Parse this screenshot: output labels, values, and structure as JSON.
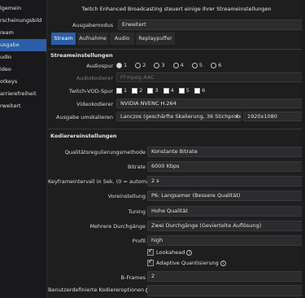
{
  "sidebar": {
    "items": [
      {
        "label": "lgemein"
      },
      {
        "label": "rscheinungsbild"
      },
      {
        "label": "ream"
      },
      {
        "label": "usgabe"
      },
      {
        "label": "udio"
      },
      {
        "label": "ideo"
      },
      {
        "label": "otkeys"
      },
      {
        "label": "arrierefreiheit"
      },
      {
        "label": "rweitert"
      }
    ],
    "active_index": 3
  },
  "banner": "Twitch Enhanced Broadcasting steuert einige Ihrer Streameinstellungen",
  "output_mode": {
    "label": "Ausgabemodus",
    "value": "Erweitert"
  },
  "tabs": [
    "Stream",
    "Aufnahme",
    "Audio",
    "Replaypuffer"
  ],
  "stream_section": {
    "title": "Streameinstellungen",
    "audio_track": {
      "label": "Audiospur",
      "options": [
        "1",
        "2",
        "3",
        "4",
        "5",
        "6"
      ],
      "selected": "1"
    },
    "audio_encoder": {
      "label": "Audiokodierer",
      "value": "FFmpeg AAC"
    },
    "vod_track": {
      "label": "Twitch-VOD-Spur",
      "options": [
        "1",
        "2",
        "3",
        "4",
        "5",
        "6"
      ]
    },
    "video_encoder": {
      "label": "Videokodierer",
      "value": "NVIDIA NVENC H.264"
    },
    "rescale": {
      "label": "Ausgabe umskalieren",
      "method": "Lanczos (geschärfte Skalierung, 36 Stichproben)",
      "resolution": "1920x1080"
    }
  },
  "encoder_section": {
    "title": "Kodierereinstellungen",
    "rate_control": {
      "label": "Qualitätsregulierungsmethode",
      "value": "Konstante Bitrate"
    },
    "bitrate": {
      "label": "Bitrate",
      "value": "6000 Kbps"
    },
    "keyframe": {
      "label": "Keyframeintervall in Sek. (0 = automatisch)",
      "value": "2 s"
    },
    "preset": {
      "label": "Voreinstellung",
      "value": "P6: Langsamer (Bessere Qualität)"
    },
    "tuning": {
      "label": "Tuning",
      "value": "Hohe Qualität"
    },
    "multipass": {
      "label": "Mehrere Durchgänge",
      "value": "Zwei Durchgänge (Geviertelte Auflösung)"
    },
    "profile": {
      "label": "Profil",
      "value": "high"
    },
    "lookahead": {
      "label": "Lookahead",
      "checked": true
    },
    "aq": {
      "label": "Adaptive Quantisierung",
      "checked": true
    },
    "bframes": {
      "label": "B-Frames",
      "value": "2"
    },
    "custom_opts": {
      "label": "Benutzerdefinierte Kodiereroptionen"
    }
  }
}
